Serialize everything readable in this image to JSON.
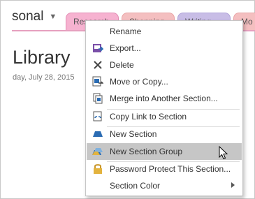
{
  "notebook": {
    "name": "sonal"
  },
  "tabs": [
    {
      "label": "Research",
      "color": "#f6b2d0"
    },
    {
      "label": "Shopping",
      "color": "#f4bfc0"
    },
    {
      "label": "Writing",
      "color": "#c8bde6"
    },
    {
      "label": "Mo",
      "color": "#f4bfc0"
    }
  ],
  "page": {
    "title": "Library",
    "date": "day, July 28, 2015"
  },
  "menu": {
    "items": [
      {
        "label": "Rename",
        "icon": "none"
      },
      {
        "label": "Export...",
        "icon": "export-icon"
      },
      {
        "label": "Delete",
        "icon": "delete-x-icon"
      },
      {
        "label": "Move or Copy...",
        "icon": "move-copy-icon"
      },
      {
        "label": "Merge into Another Section...",
        "icon": "merge-icon"
      },
      {
        "label": "Copy Link to Section",
        "icon": "link-icon"
      },
      {
        "label": "New Section",
        "icon": "new-section-icon"
      },
      {
        "label": "New Section Group",
        "icon": "section-group-icon",
        "highlighted": true
      },
      {
        "label": "Password Protect This Section...",
        "icon": "lock-icon"
      },
      {
        "label": "Section Color",
        "icon": "none",
        "has_submenu": true
      }
    ]
  },
  "colors": {
    "highlight": "#c6c6c6",
    "accent_blue": "#2b6cb3",
    "lock": "#e3b33e"
  }
}
